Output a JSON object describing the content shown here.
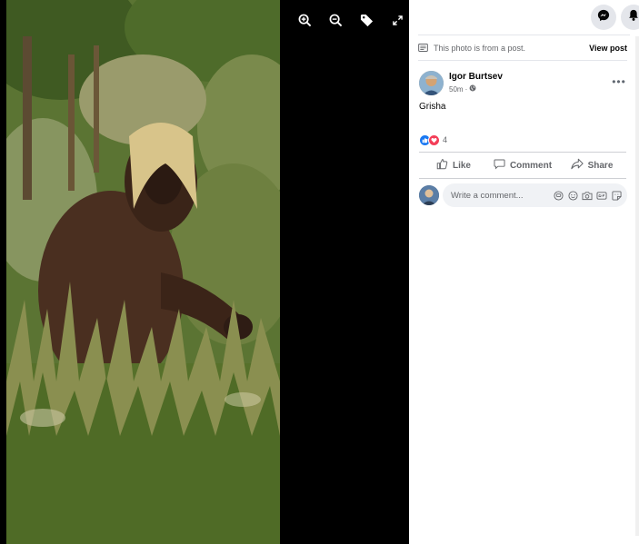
{
  "viewer": {
    "toolbar": {
      "zoom_in": "zoom-in-icon",
      "zoom_out": "zoom-out-icon",
      "tag": "tag-icon",
      "fullscreen": "expand-icon"
    }
  },
  "header": {
    "messenger_icon": "messenger-icon",
    "notifications_icon": "bell-icon"
  },
  "notice": {
    "text": "This photo is from a post.",
    "link": "View post"
  },
  "post": {
    "author": "Igor Burtsev",
    "time": "50m",
    "audience_icon": "globe-icon",
    "caption": "Grisha",
    "reaction_count": "4"
  },
  "actions": {
    "like": "Like",
    "comment": "Comment",
    "share": "Share"
  },
  "comment": {
    "placeholder": "Write a comment..."
  },
  "colors": {
    "like_blue": "#1877f2",
    "love_red": "#f33e58",
    "panel_bg": "#ffffff",
    "viewer_bg": "#000000"
  }
}
